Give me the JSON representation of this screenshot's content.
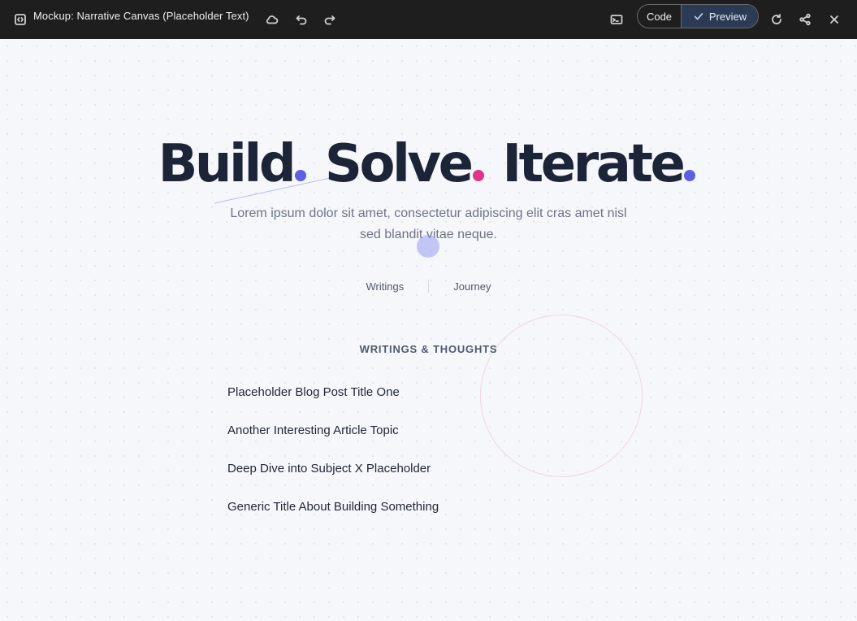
{
  "window": {
    "title": "Mockup: Narrative Canvas (Placeholder Text)",
    "code_label": "Code",
    "preview_label": "Preview"
  },
  "hero": {
    "words": [
      "Build",
      "Solve",
      "Iterate"
    ],
    "dot_colors": [
      "#5b5fe0",
      "#e0358a",
      "#5b5fe0"
    ],
    "subtitle": "Lorem ipsum dolor sit amet, consectetur adipiscing elit cras amet nisl sed blandit vitae neque."
  },
  "nav": {
    "items": [
      "Writings",
      "Journey"
    ]
  },
  "writings": {
    "heading": "WRITINGS & THOUGHTS",
    "posts": [
      "Placeholder Blog Post Title One",
      "Another Interesting Article Topic",
      "Deep Dive into Subject X Placeholder",
      "Generic Title About Building Something"
    ]
  }
}
